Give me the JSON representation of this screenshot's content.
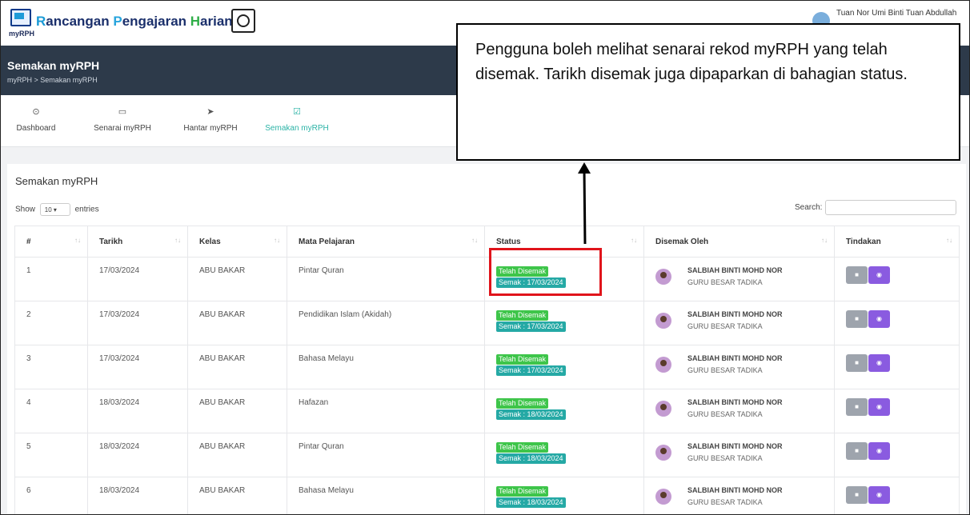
{
  "header": {
    "logo_sub": "myRPH",
    "brand": {
      "w1_cap": "R",
      "w1_rest": "ancangan",
      "w2_cap": "P",
      "w2_rest": "engajaran",
      "w3_cap": "H",
      "w3_rest": "arian"
    },
    "user_name": "Tuan Nor Umi Binti Tuan Abdullah"
  },
  "page": {
    "title": "Semakan myRPH",
    "breadcrumb": "myRPH  >  Semakan myRPH"
  },
  "nav": {
    "items": [
      {
        "label": "Dashboard",
        "icon": "dashboard-icon",
        "glyph": "⊙"
      },
      {
        "label": "Senarai myRPH",
        "icon": "monitor-icon",
        "glyph": "▭"
      },
      {
        "label": "Hantar myRPH",
        "icon": "send-icon",
        "glyph": "➤"
      },
      {
        "label": "Semakan myRPH",
        "icon": "check-square-icon",
        "glyph": "☑",
        "active": true
      }
    ]
  },
  "card": {
    "title": "Semakan myRPH",
    "show_label": "Show",
    "entries_value": "10",
    "entries_label": "entries",
    "search_label": "Search:"
  },
  "table": {
    "columns": [
      "#",
      "Tarikh",
      "Kelas",
      "Mata Pelajaran",
      "Status",
      "Disemak Oleh",
      "Tindakan"
    ],
    "rows": [
      {
        "no": "1",
        "tarikh": "17/03/2024",
        "kelas": "ABU BAKAR",
        "mata": "Pintar Quran",
        "status": "Telah Disemak",
        "semak": "Semak : 17/03/2024",
        "nama": "SALBIAH BINTI MOHD NOR",
        "jawatan": "GURU BESAR TADIKA"
      },
      {
        "no": "2",
        "tarikh": "17/03/2024",
        "kelas": "ABU BAKAR",
        "mata": "Pendidikan Islam (Akidah)",
        "status": "Telah Disemak",
        "semak": "Semak : 17/03/2024",
        "nama": "SALBIAH BINTI MOHD NOR",
        "jawatan": "GURU BESAR TADIKA"
      },
      {
        "no": "3",
        "tarikh": "17/03/2024",
        "kelas": "ABU BAKAR",
        "mata": "Bahasa Melayu",
        "status": "Telah Disemak",
        "semak": "Semak : 17/03/2024",
        "nama": "SALBIAH BINTI MOHD NOR",
        "jawatan": "GURU BESAR TADIKA"
      },
      {
        "no": "4",
        "tarikh": "18/03/2024",
        "kelas": "ABU BAKAR",
        "mata": "Hafazan",
        "status": "Telah Disemak",
        "semak": "Semak : 18/03/2024",
        "nama": "SALBIAH BINTI MOHD NOR",
        "jawatan": "GURU BESAR TADIKA"
      },
      {
        "no": "5",
        "tarikh": "18/03/2024",
        "kelas": "ABU BAKAR",
        "mata": "Pintar Quran",
        "status": "Telah Disemak",
        "semak": "Semak : 18/03/2024",
        "nama": "SALBIAH BINTI MOHD NOR",
        "jawatan": "GURU BESAR TADIKA"
      },
      {
        "no": "6",
        "tarikh": "18/03/2024",
        "kelas": "ABU BAKAR",
        "mata": "Bahasa Melayu",
        "status": "Telah Disemak",
        "semak": "Semak : 18/03/2024",
        "nama": "SALBIAH BINTI MOHD NOR",
        "jawatan": "GURU BESAR TADIKA"
      }
    ]
  },
  "callout": {
    "text": "Pengguna boleh melihat senarai rekod myRPH yang telah disemak. Tarikh disemak juga dipaparkan di bahagian status."
  },
  "colors": {
    "accent": "#2bb3a6",
    "header_dark": "#2d3a4a",
    "badge_reviewed": "#3ec54a",
    "badge_date": "#25a9a5",
    "view_button": "#8a5be0",
    "highlight": "#e0141b"
  }
}
